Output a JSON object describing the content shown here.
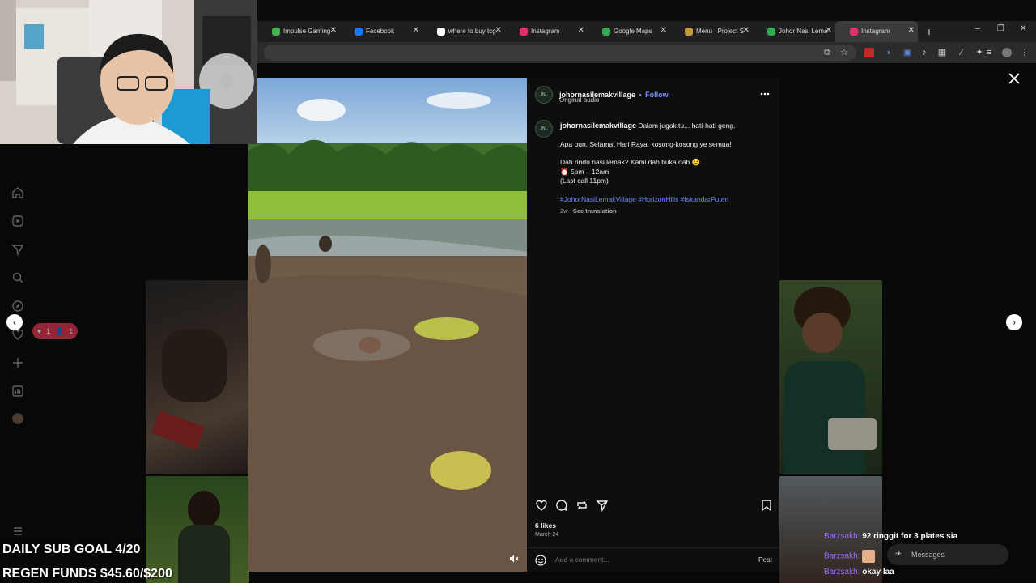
{
  "browser": {
    "tabs": [
      {
        "label": "Impulse Gaming",
        "favicon_color": "#4caf50",
        "active": false
      },
      {
        "label": "Facebook",
        "favicon_color": "#1877f2",
        "active": false
      },
      {
        "label": "where to buy tcg",
        "favicon_color": "#ffffff",
        "active": false
      },
      {
        "label": "Instagram",
        "favicon_color": "#e1306c",
        "active": false
      },
      {
        "label": "Google Maps",
        "favicon_color": "#34a853",
        "active": false
      },
      {
        "label": "Menu | Project S",
        "favicon_color": "#c49a3c",
        "active": false
      },
      {
        "label": "Johor Nasi Lemak",
        "favicon_color": "#34a853",
        "active": false
      },
      {
        "label": "Instagram",
        "favicon_color": "#e1306c",
        "active": true
      }
    ],
    "new_tab": "+",
    "window_controls": [
      "–",
      "❐",
      "✕"
    ]
  },
  "sidebar": {
    "icons": [
      "home-icon",
      "reels-icon",
      "messages-icon",
      "search-icon",
      "explore-icon",
      "notifications-icon",
      "create-icon",
      "dashboard-icon",
      "profile-icon",
      "more-icon"
    ],
    "notif_badge": {
      "likes": "1",
      "follows": "1"
    }
  },
  "post": {
    "avatar_text": "JNL",
    "username": "johornasilemakvillage",
    "follow_label": "Follow",
    "separator": "•",
    "audio_label": "Original audio",
    "more_icon": "more-options-icon",
    "caption": {
      "username": "johornasilemakvillage",
      "line1": "Dalam jugak tu... hati-hati geng.",
      "line2": "Apa pun, Selamat Hari Raya, kosong-kosong ye semua!",
      "line3": "Dah rindu nasi lemak? Kami dah buka dah 😉",
      "line4": "⏰ 5pm – 12am",
      "line5": "(Last call 11pm)",
      "hashtags": "#JohorNasiLemakVillage #HorizonHills #IskandarPuteri"
    },
    "age": "2w",
    "see_translation": "See translation",
    "likes": "6 likes",
    "date": "March 24",
    "comment_placeholder": "Add a comment...",
    "post_button": "Post"
  },
  "stream": {
    "goal_line1": "DAILY SUB GOAL 4/20",
    "goal_line2": "REGEN FUNDS $45.60/$200",
    "chat": [
      {
        "name": "Barzsakh:",
        "msg": "92 ringgit for 3 plates sia"
      },
      {
        "name": "Barzsakh:",
        "msg": ""
      },
      {
        "name": "Barzsakh:",
        "msg": "okay laa"
      }
    ],
    "messages_label": "Messages"
  }
}
